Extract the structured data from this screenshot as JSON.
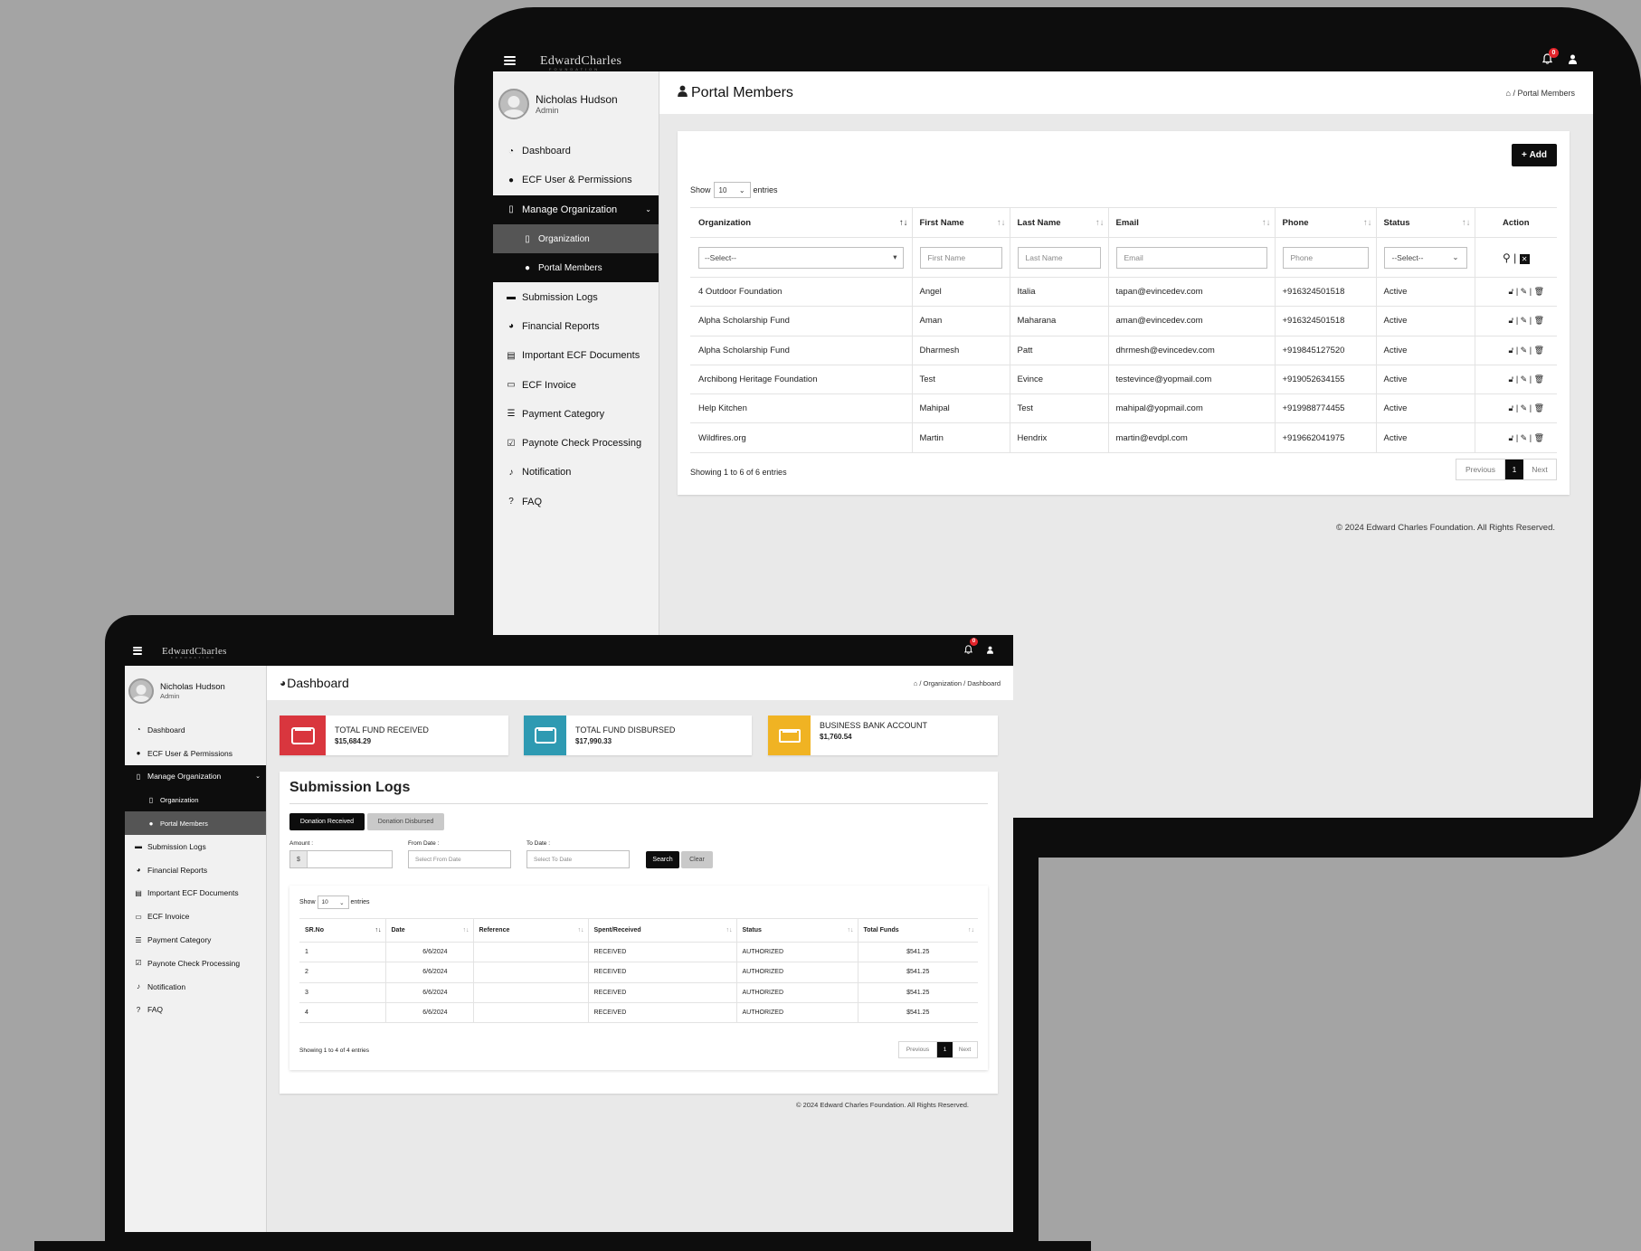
{
  "brand": {
    "name": "EdwardCharles",
    "sub": "Foundation"
  },
  "notifications_count": "0",
  "user": {
    "name": "Nicholas Hudson",
    "role": "Admin"
  },
  "sidebar": {
    "items": [
      {
        "label": "Dashboard",
        "icon": "dashboard-icon"
      },
      {
        "label": "ECF User & Permissions",
        "icon": "user-icon"
      },
      {
        "label": "Manage Organization",
        "icon": "building-icon"
      },
      {
        "label": "Organization",
        "icon": "building-icon"
      },
      {
        "label": "Portal Members",
        "icon": "user-icon"
      },
      {
        "label": "Submission Logs",
        "icon": "credit-card-icon"
      },
      {
        "label": "Financial Reports",
        "icon": "pie-chart-icon"
      },
      {
        "label": "Important ECF Documents",
        "icon": "file-icon"
      },
      {
        "label": "ECF Invoice",
        "icon": "invoice-icon"
      },
      {
        "label": "Payment Category",
        "icon": "list-icon"
      },
      {
        "label": "Paynote Check Processing",
        "icon": "check-square-icon"
      },
      {
        "label": "Notification",
        "icon": "bell-icon"
      },
      {
        "label": "FAQ",
        "icon": "question-icon"
      }
    ]
  },
  "tablet": {
    "title": "Portal Members",
    "breadcrumb": [
      "Portal Members"
    ],
    "add_label": "Add",
    "show_label": "Show",
    "entries_value": "10",
    "entries_label": "entries",
    "columns": [
      "Organization",
      "First Name",
      "Last Name",
      "Email",
      "Phone",
      "Status",
      "Action"
    ],
    "filters": {
      "organization": "--Select--",
      "first_name": "First Name",
      "last_name": "Last Name",
      "email": "Email",
      "phone": "Phone",
      "status": "--Select--"
    },
    "rows": [
      {
        "org": "4 Outdoor Foundation",
        "first": "Angel",
        "last": "Italia",
        "email": "tapan@evincedev.com",
        "phone": "+916324501518",
        "status": "Active"
      },
      {
        "org": "Alpha Scholarship Fund",
        "first": "Aman",
        "last": "Maharana",
        "email": "aman@evincedev.com",
        "phone": "+916324501518",
        "status": "Active"
      },
      {
        "org": "Alpha Scholarship Fund",
        "first": "Dharmesh",
        "last": "Patt",
        "email": "dhrmesh@evincedev.com",
        "phone": "+919845127520",
        "status": "Active"
      },
      {
        "org": "Archibong Heritage Foundation",
        "first": "Test",
        "last": "Evince",
        "email": "testevince@yopmail.com",
        "phone": "+919052634155",
        "status": "Active"
      },
      {
        "org": "Help Kitchen",
        "first": "Mahipal",
        "last": "Test",
        "email": "mahipal@yopmail.com",
        "phone": "+919988774455",
        "status": "Active"
      },
      {
        "org": "Wildfires.org",
        "first": "Martin",
        "last": "Hendrix",
        "email": "martin@evdpl.com",
        "phone": "+919662041975",
        "status": "Active"
      }
    ],
    "info": "Showing 1 to 6 of 6 entries",
    "pager": {
      "prev": "Previous",
      "page": "1",
      "next": "Next"
    },
    "footer": "© 2024 Edward Charles Foundation. All Rights Reserved."
  },
  "laptop": {
    "title": "Dashboard",
    "breadcrumb": [
      "Organization",
      "Dashboard"
    ],
    "cards": [
      {
        "label": "TOTAL FUND RECEIVED",
        "value": "$15,684.29",
        "color": "#d9363e",
        "icon": "credit-card-icon"
      },
      {
        "label": "TOTAL FUND DISBURSED",
        "value": "$17,990.33",
        "color": "#2e9ab2",
        "icon": "credit-card-icon"
      },
      {
        "label": "BUSINESS BANK ACCOUNT",
        "value": "$1,760.54",
        "color": "#f0b323",
        "icon": "money-icon"
      }
    ],
    "section_title": "Submission Logs",
    "tabs": [
      "Donation Received",
      "Donation Disbursed"
    ],
    "filters": {
      "amount_label": "Amount :",
      "currency": "$",
      "from_label": "From Date :",
      "from_placeholder": "Select From Date",
      "to_label": "To Date :",
      "to_placeholder": "Select To Date",
      "search": "Search",
      "clear": "Clear"
    },
    "show_label": "Show",
    "entries_value": "10",
    "entries_label": "entries",
    "columns": [
      "SR.No",
      "Date",
      "Reference",
      "Spent/Received",
      "Status",
      "Total Funds"
    ],
    "rows": [
      {
        "sr": "1",
        "date": "6/6/2024",
        "ref": "",
        "kind": "RECEIVED",
        "status": "AUTHORIZED",
        "total": "$541.25"
      },
      {
        "sr": "2",
        "date": "6/6/2024",
        "ref": "",
        "kind": "RECEIVED",
        "status": "AUTHORIZED",
        "total": "$541.25"
      },
      {
        "sr": "3",
        "date": "6/6/2024",
        "ref": "",
        "kind": "RECEIVED",
        "status": "AUTHORIZED",
        "total": "$541.25"
      },
      {
        "sr": "4",
        "date": "6/6/2024",
        "ref": "",
        "kind": "RECEIVED",
        "status": "AUTHORIZED",
        "total": "$541.25"
      }
    ],
    "info": "Showing 1 to 4 of 4 entries",
    "pager": {
      "prev": "Previous",
      "page": "1",
      "next": "Next"
    },
    "footer": "© 2024 Edward Charles Foundation. All Rights Reserved."
  }
}
